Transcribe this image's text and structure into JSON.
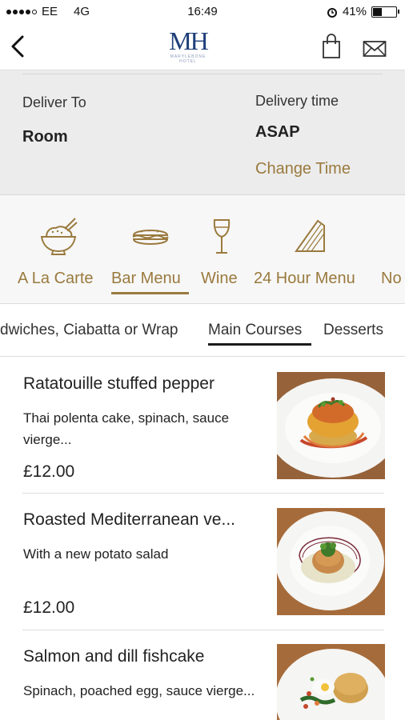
{
  "status_bar": {
    "carrier": "EE",
    "network": "4G",
    "time": "16:49",
    "battery": "41%",
    "battery_level": 0.41
  },
  "header": {
    "logo_text": "MH",
    "logo_sub": "MARYLEBONE HOTEL"
  },
  "delivery": {
    "deliver_to_label": "Deliver To",
    "deliver_to_value": "Room",
    "time_label": "Delivery time",
    "time_value": "ASAP",
    "change_time": "Change Time"
  },
  "categories": [
    {
      "label": "A La Carte",
      "icon": "bowl-icon"
    },
    {
      "label": "Bar Menu",
      "icon": "sandwich-icon",
      "selected": true
    },
    {
      "label": "Wine",
      "icon": "wine-glass-icon"
    },
    {
      "label": "24 Hour Menu",
      "icon": "sandwich-wedge-icon"
    },
    {
      "label": "No",
      "icon": ""
    }
  ],
  "subtabs": [
    {
      "label": "dwiches, Ciabatta or Wrap"
    },
    {
      "label": "Main Courses",
      "selected": true
    },
    {
      "label": "Desserts"
    }
  ],
  "menu_items": [
    {
      "name": "Ratatouille stuffed pepper",
      "description": "Thai polenta cake, spinach, sauce vierge...",
      "price": "£12.00"
    },
    {
      "name": "Roasted Mediterranean ve...",
      "description": "With a new potato salad",
      "price": "£12.00"
    },
    {
      "name": "Salmon and dill fishcake",
      "description": "Spinach, poached egg, sauce vierge...",
      "price": ""
    }
  ],
  "colors": {
    "accent": "#9a7a3e",
    "logo_blue": "#1f3f7a",
    "panel_bg": "#ececec"
  }
}
